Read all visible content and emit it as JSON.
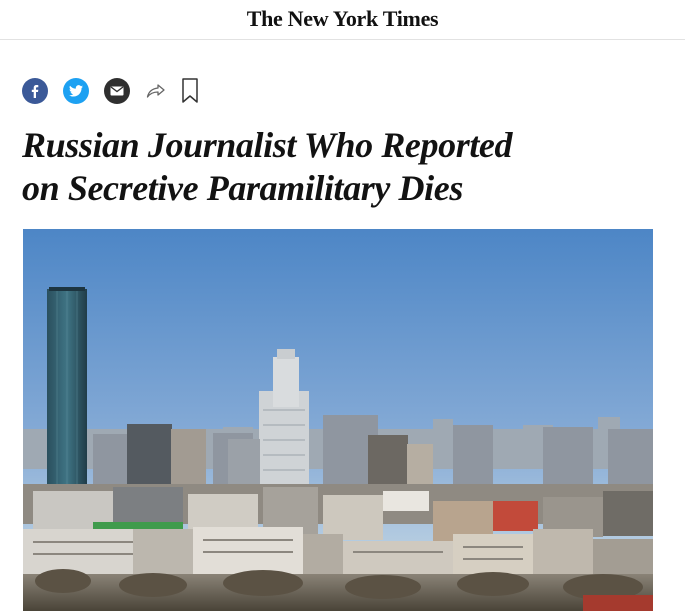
{
  "masthead": {
    "logo": "The New York Times"
  },
  "share": {
    "facebook": "facebook-icon",
    "twitter": "twitter-icon",
    "email": "email-icon",
    "share": "share-arrow-icon",
    "save": "bookmark-icon"
  },
  "article": {
    "headline_line1": "Russian Journalist Who Reported",
    "headline_line2": "on Secretive Paramilitary Dies"
  },
  "colors": {
    "facebook": "#3b5998",
    "twitter": "#1da1f2",
    "email": "#2f2f2f",
    "sky_top": "#4d86c6",
    "sky_bottom": "#b9cfe2"
  }
}
